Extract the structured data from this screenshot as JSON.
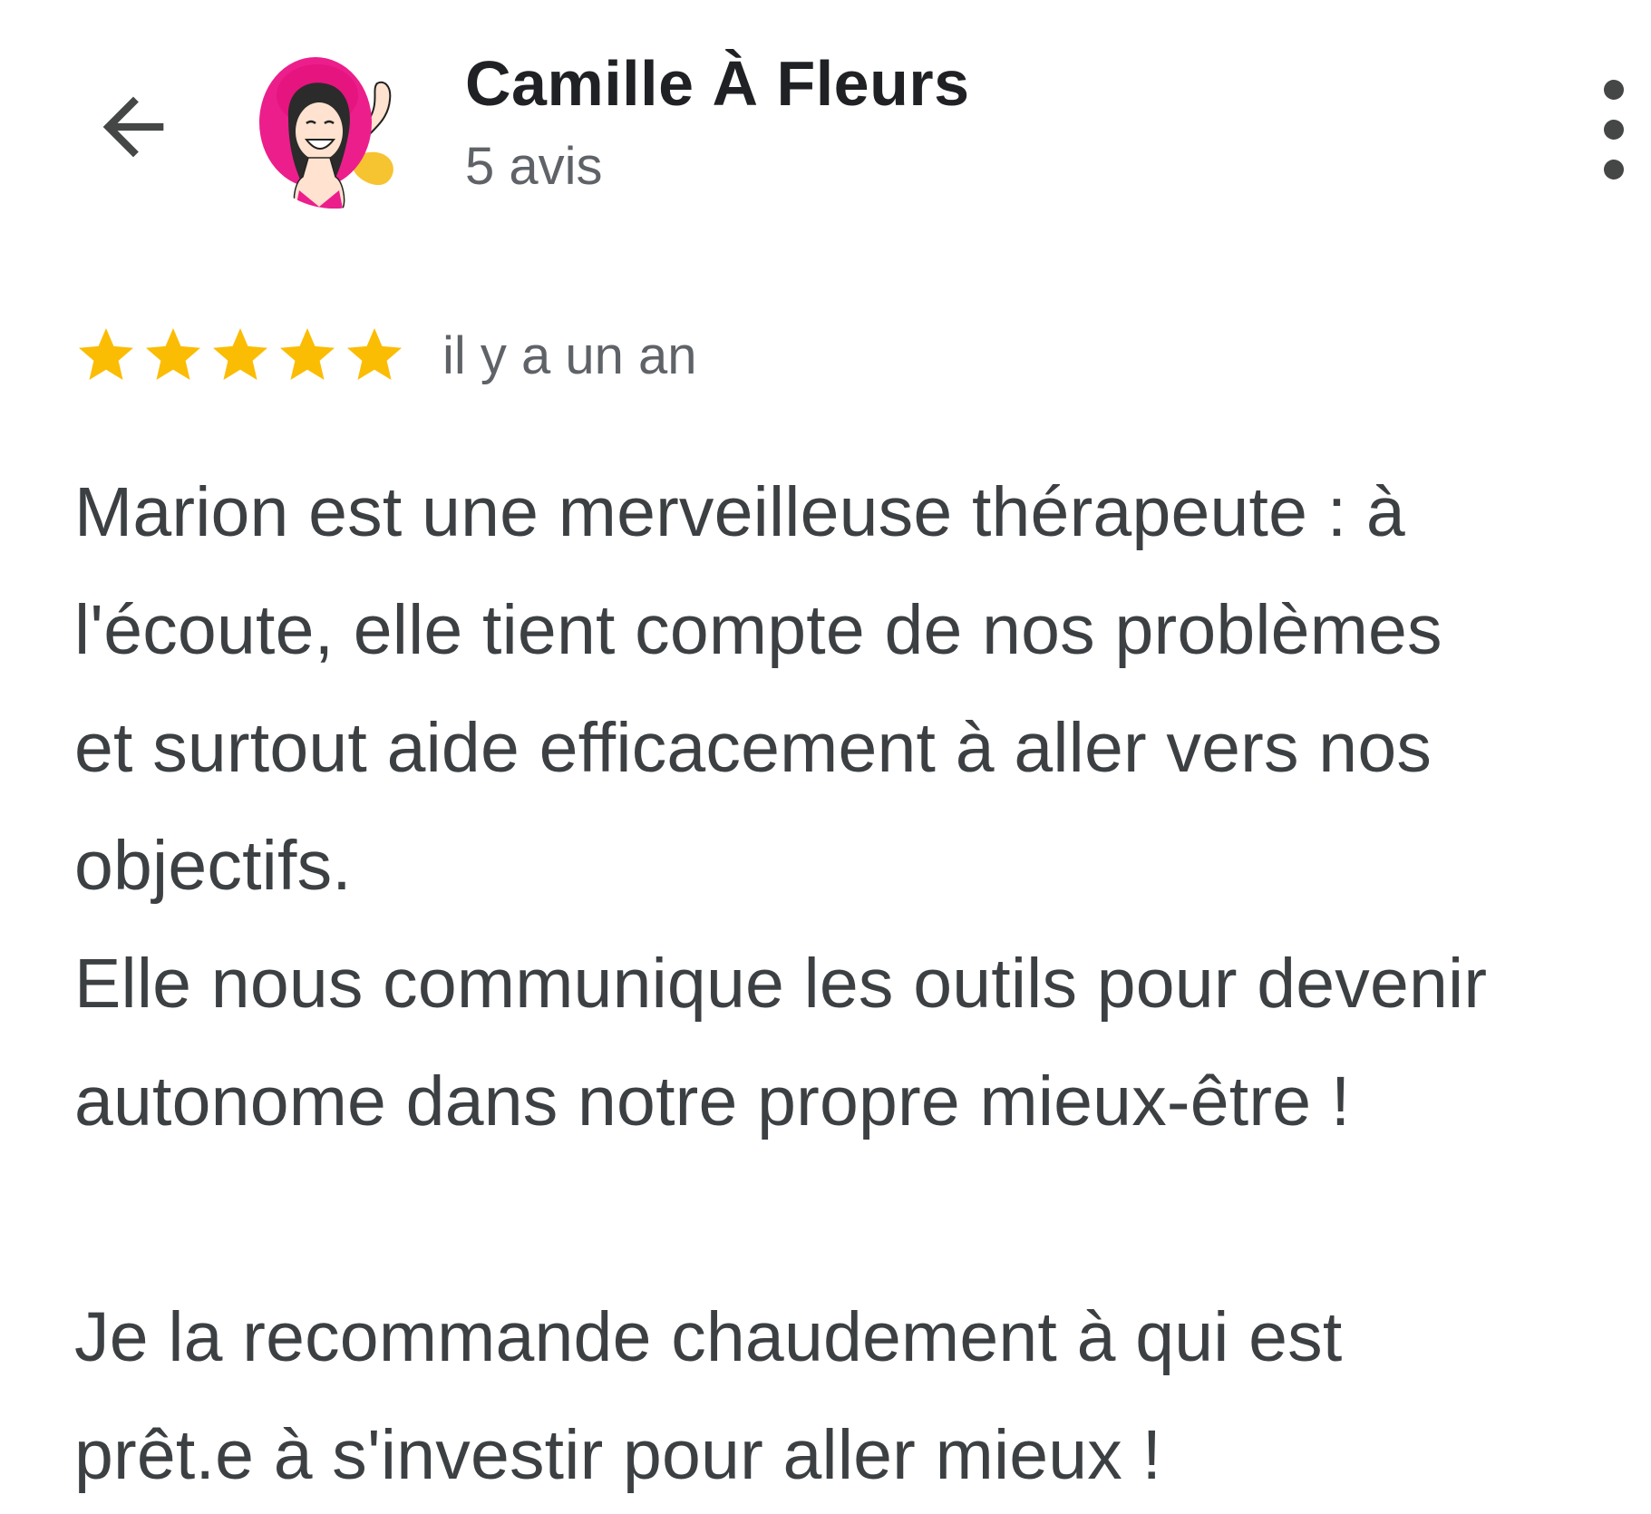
{
  "header": {
    "back_icon": "arrow-back-icon",
    "reviewer_name": "Camille À Fleurs",
    "review_count": "5 avis",
    "more_icon": "more-vert-icon"
  },
  "review": {
    "rating": 5,
    "rating_max": 5,
    "star_color": "#fbbc04",
    "date": "il y a un an",
    "body": "Marion est une merveilleuse thérapeute : à\nl'écoute, elle tient compte de nos problèmes\net surtout aide efficacement à aller vers nos\nobjectifs.\nElle nous communique les outils pour devenir\nautonome dans notre propre mieux-être !\n\nJe la recommande chaudement à qui est\nprêt.e à s'investir pour aller mieux !"
  }
}
